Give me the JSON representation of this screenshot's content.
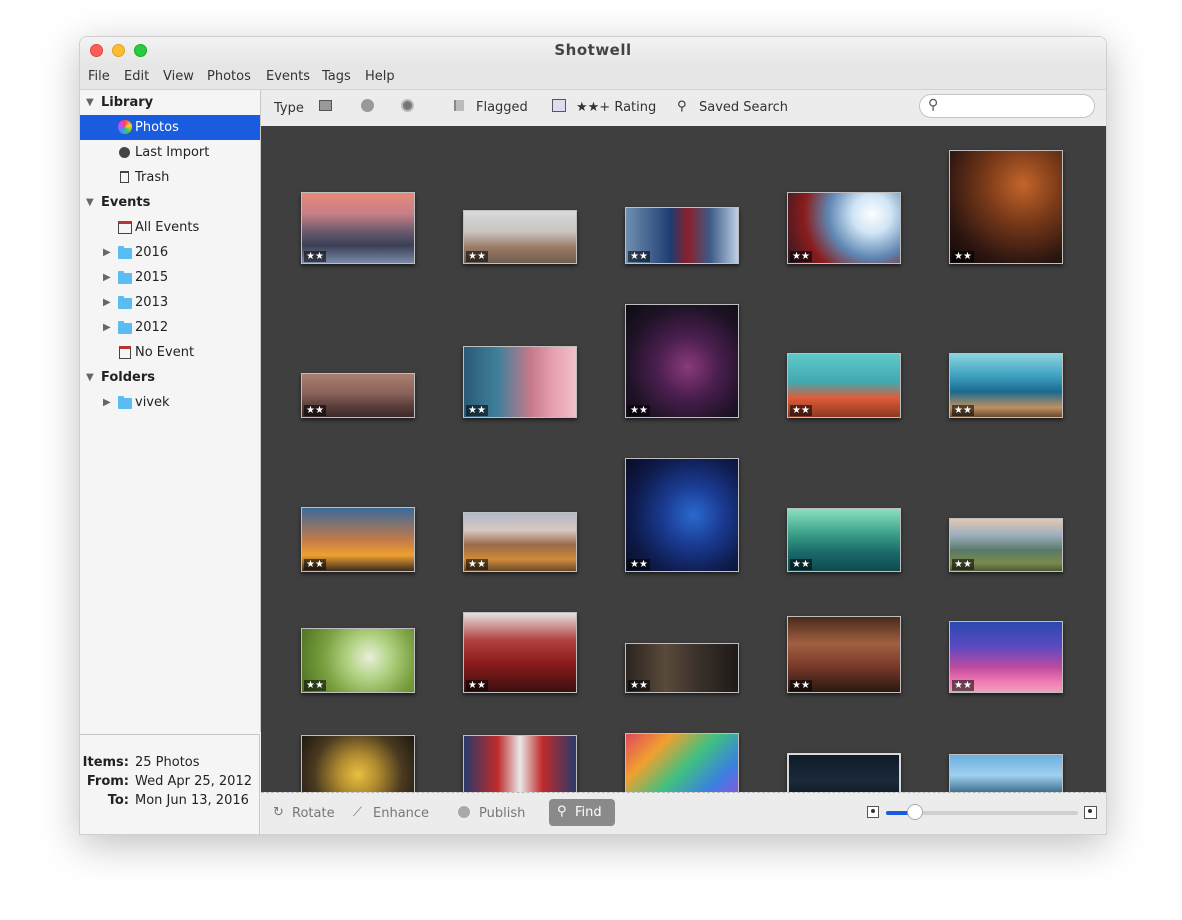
{
  "window": {
    "title": "Shotwell"
  },
  "menu": [
    "File",
    "Edit",
    "View",
    "Photos",
    "Events",
    "Tags",
    "Help"
  ],
  "sidebar": {
    "library": {
      "label": "Library",
      "items": [
        {
          "label": "Photos",
          "icon": "photos-icon"
        },
        {
          "label": "Last Import",
          "icon": "clock-icon"
        },
        {
          "label": "Trash",
          "icon": "trash-icon"
        }
      ]
    },
    "events": {
      "label": "Events",
      "items": [
        {
          "label": "All Events",
          "icon": "events-icon"
        },
        {
          "label": "2016",
          "icon": "folder-icon"
        },
        {
          "label": "2015",
          "icon": "folder-icon"
        },
        {
          "label": "2013",
          "icon": "folder-icon"
        },
        {
          "label": "2012",
          "icon": "folder-icon"
        },
        {
          "label": "No Event",
          "icon": "no-event-icon"
        }
      ]
    },
    "folders": {
      "label": "Folders",
      "items": [
        {
          "label": "vivek",
          "icon": "folder-icon"
        }
      ]
    }
  },
  "info": {
    "items_label": "Items:",
    "items_value": "25 Photos",
    "from_label": "From:",
    "from_value": "Wed Apr 25, 2012",
    "to_label": "To:",
    "to_value": "Mon Jun 13, 2016"
  },
  "toolbar": {
    "type_label": "Type",
    "flagged_label": "Flagged",
    "rating_label": "★★+ Rating",
    "saved_search_label": "Saved Search",
    "search_placeholder": ""
  },
  "grid": {
    "rating": "★★"
  },
  "bottombar": {
    "rotate_label": "Rotate",
    "enhance_label": "Enhance",
    "publish_label": "Publish",
    "find_label": "Find",
    "zoom_level": 0.15
  }
}
